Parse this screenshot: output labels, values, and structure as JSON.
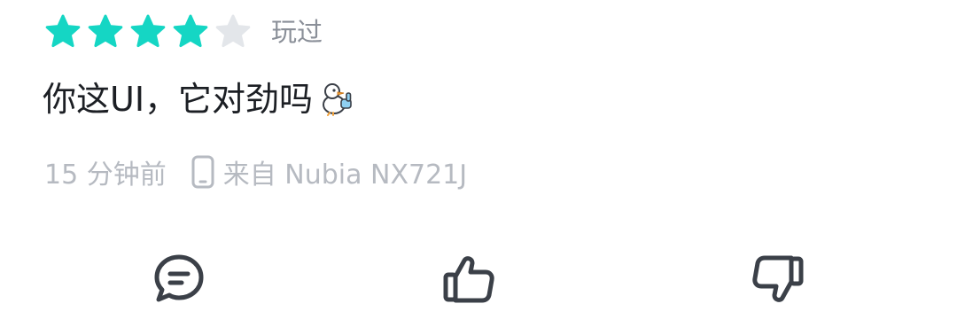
{
  "review": {
    "rating": 4,
    "rating_max": 5,
    "status_label": "玩过",
    "comment_text": "你这UI，它对劲吗",
    "emoji": "duck-thumbs-up-emoji",
    "time_ago": "15 分钟前",
    "device_label": "来自 Nubia NX721J"
  },
  "icons": {
    "star_filled": "star-filled-icon",
    "star_empty": "star-empty-icon",
    "phone": "phone-icon",
    "comment": "comment-bubble-icon",
    "like": "thumbs-up-icon",
    "dislike": "thumbs-down-icon"
  },
  "colors": {
    "star_filled": "#15d6c4",
    "star_empty": "#e3e6ea",
    "icon_stroke": "#3b4048",
    "meta_text": "#b6bac1",
    "comment_text": "#1c1f24"
  }
}
